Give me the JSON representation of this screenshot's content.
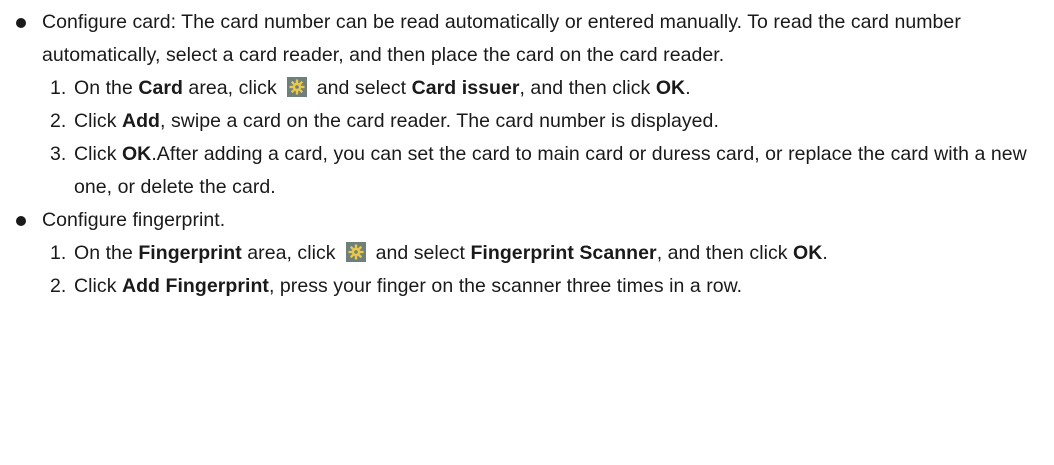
{
  "bullets": [
    {
      "intro": "Configure card: The card number can be read automatically or entered manually. To read the card number automatically, select a card reader, and then place the card on the card reader.",
      "steps": [
        {
          "num": "1.",
          "t1": "On the ",
          "b1": "Card",
          "t2": " area, click",
          "t3": "and select ",
          "b2": "Card issuer",
          "t4": ", and then click ",
          "b3": "OK",
          "t5": "."
        },
        {
          "num": "2.",
          "t1": "Click ",
          "b1": "Add",
          "t2": ", swipe a card on the card reader. The card number is displayed."
        },
        {
          "num": "3.",
          "t1": "Click ",
          "b1": "OK",
          "t2": ".After adding a card, you can set the card to main card or duress card, or replace the card with a new one, or delete the card."
        }
      ]
    },
    {
      "intro": "Configure fingerprint.",
      "steps": [
        {
          "num": "1.",
          "t1": "On the ",
          "b1": "Fingerprint",
          "t2": " area, click",
          "t3": "and select ",
          "b2": "Fingerprint Scanner",
          "t4": ", and then click ",
          "b3": "OK",
          "t5": "."
        },
        {
          "num": "2.",
          "t1": "Click ",
          "b1": "Add Fingerprint",
          "t2": ", press your finger on the scanner three times in a row."
        }
      ]
    }
  ],
  "icons": {
    "settings": "gear-icon"
  }
}
